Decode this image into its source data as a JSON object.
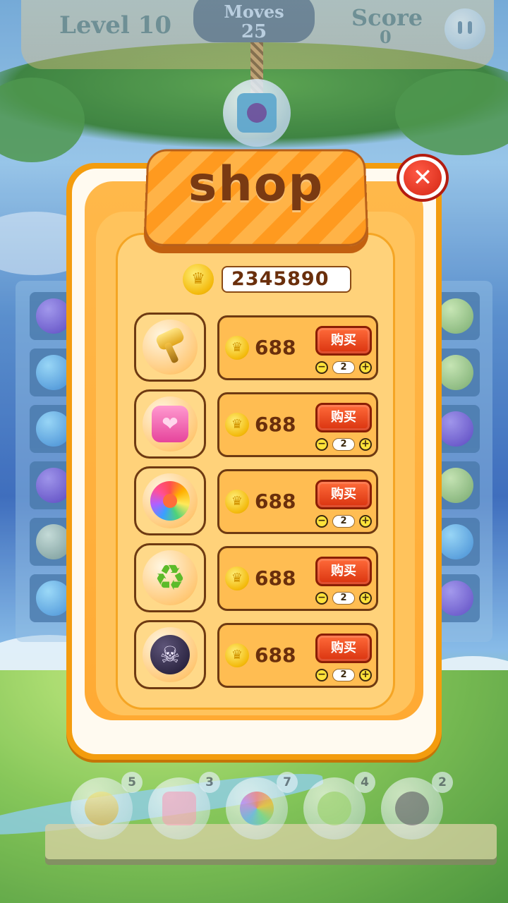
{
  "hud": {
    "level": "Level 10",
    "moves_label": "Moves",
    "moves_value": "25",
    "score_label": "Score",
    "score_value": "0"
  },
  "shop": {
    "title": "shop",
    "balance": "2345890",
    "items": [
      {
        "name": "hammer",
        "price": "688",
        "buy_label": "购买",
        "quantity": "2"
      },
      {
        "name": "heart",
        "price": "688",
        "buy_label": "购买",
        "quantity": "2"
      },
      {
        "name": "candy",
        "price": "688",
        "buy_label": "购买",
        "quantity": "2"
      },
      {
        "name": "shuffle",
        "price": "688",
        "buy_label": "购买",
        "quantity": "2"
      },
      {
        "name": "skull-bomb",
        "price": "688",
        "buy_label": "购买",
        "quantity": "2"
      }
    ]
  },
  "boosters": [
    {
      "name": "hammer",
      "count": "5"
    },
    {
      "name": "heart",
      "count": "3"
    },
    {
      "name": "candy",
      "count": "7"
    },
    {
      "name": "shuffle",
      "count": "4"
    },
    {
      "name": "skull-bomb",
      "count": "2"
    }
  ],
  "icons": {
    "close": "close-icon",
    "coin": "crown-coin-icon",
    "minus": "minus-icon",
    "plus": "plus-icon"
  },
  "colors": {
    "modal_border": "#f39c0e",
    "buy_button": "#d9330f",
    "close_button": "#d42614",
    "price_text": "#6a2f0c"
  }
}
